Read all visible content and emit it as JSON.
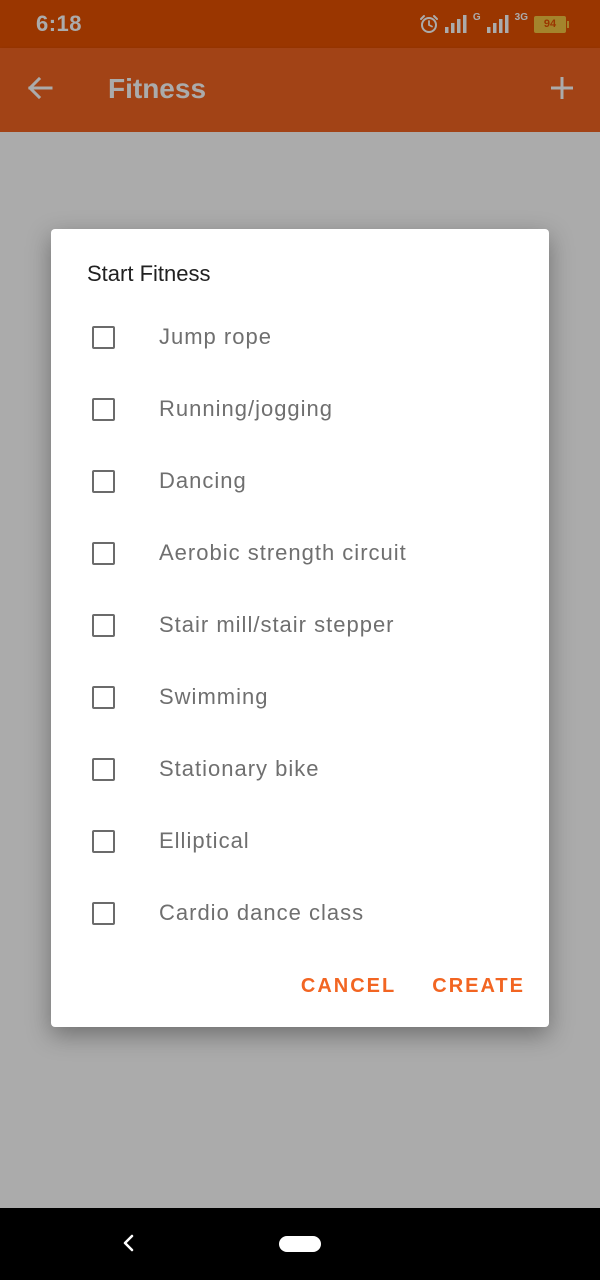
{
  "status_bar": {
    "time": "6:18",
    "network_label_1": "G",
    "network_label_2": "3G",
    "battery": "94"
  },
  "app_bar": {
    "title": "Fitness",
    "back_icon": "arrow-back-icon",
    "add_icon": "plus-icon"
  },
  "dialog": {
    "title": "Start Fitness",
    "options": [
      {
        "label": "Jump rope",
        "checked": false
      },
      {
        "label": "Running/jogging",
        "checked": false
      },
      {
        "label": "Dancing",
        "checked": false
      },
      {
        "label": "Aerobic strength circuit",
        "checked": false
      },
      {
        "label": "Stair mill/stair stepper",
        "checked": false
      },
      {
        "label": "Swimming",
        "checked": false
      },
      {
        "label": "Stationary bike",
        "checked": false
      },
      {
        "label": "Elliptical",
        "checked": false
      },
      {
        "label": "Cardio dance class",
        "checked": false
      }
    ],
    "cancel_label": "CANCEL",
    "create_label": "CREATE"
  },
  "colors": {
    "status_bar": "#E65100",
    "app_bar": "#F26522",
    "accent": "#F26522"
  }
}
